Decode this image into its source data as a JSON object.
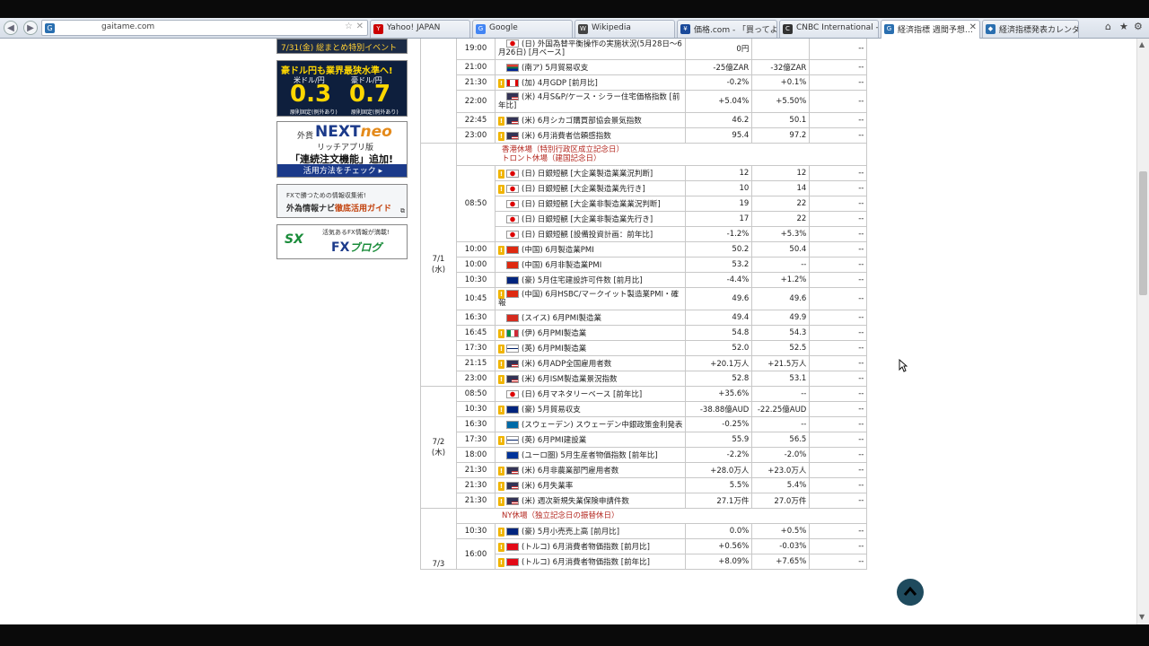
{
  "browser": {
    "address": "gaitame.com",
    "tabs": [
      {
        "label": "Yahoo! JAPAN",
        "color": "#c00",
        "fav": "Y"
      },
      {
        "label": "Google",
        "color": "#4285f4",
        "fav": "G"
      },
      {
        "label": "Wikipedia",
        "color": "#444",
        "fav": "W"
      },
      {
        "label": "価格.com - 「買ってよ…",
        "color": "#1a4a9a",
        "fav": "¥"
      },
      {
        "label": "CNBC International -…",
        "color": "#333",
        "fav": "C"
      },
      {
        "label": "経済指標 週間予想…",
        "color": "#2a6fb0",
        "fav": "G",
        "active": true
      },
      {
        "label": "経済指標発表カレンダ…",
        "color": "#2a6fb0",
        "fav": "◆"
      }
    ]
  },
  "sidebar": {
    "b0": "7/31(金) 総まとめ特別イベント開催!",
    "b1": {
      "headline": "豪ドル円も業界最狭水準へ!",
      "pair1": "米ドル/円",
      "pair2": "豪ドル/円",
      "val1": "0.3",
      "val2": "0.7",
      "unit": "銭",
      "note1": "原則固定(例外あり)",
      "note2": "原則固定(例外あり)"
    },
    "b2": {
      "prefix": "外貨",
      "logo1": "NEXT",
      "logo2": "neo",
      "sub": "リッチアプリ版",
      "feature": "「連続注文機能」追加!",
      "cta": "活用方法をチェック ▸"
    },
    "b3": {
      "line1": "FXで勝つための情報収集術!",
      "line2a": "外為情報ナビ",
      "line2b": "徹底活用ガイド"
    },
    "b4": {
      "logo": "SX",
      "line1": "活気あるFX情報が満載!",
      "line2": "FX",
      "line2b": "ブログ"
    }
  },
  "calendar": {
    "group0": [
      {
        "time": "19:00",
        "imp": false,
        "flag": "jp",
        "event": "(日) 外国為替平衡操作の実施状況(5月28日～6月26日) [月ベース]",
        "wrap": true,
        "prev": "0円",
        "fcst": "",
        "res": "--"
      },
      {
        "time": "21:00",
        "imp": false,
        "flag": "za",
        "event": "(南ア) 5月貿易収支",
        "prev": "-25億ZAR",
        "fcst": "-32億ZAR",
        "res": "--"
      },
      {
        "time": "21:30",
        "imp": true,
        "flag": "ca",
        "event": "(加) 4月GDP [前月比]",
        "prev": "-0.2%",
        "fcst": "+0.1%",
        "res": "--"
      },
      {
        "time": "22:00",
        "imp": false,
        "flag": "us",
        "event": "(米) 4月S&P/ケース・シラー住宅価格指数 [前年比]",
        "wrap": true,
        "prev": "+5.04%",
        "fcst": "+5.50%",
        "res": "--"
      },
      {
        "time": "22:45",
        "imp": true,
        "flag": "us",
        "event": "(米) 6月シカゴ購買部協会景気指数",
        "prev": "46.2",
        "fcst": "50.1",
        "res": "--"
      },
      {
        "time": "23:00",
        "imp": true,
        "flag": "us",
        "event": "(米) 6月消費者信頼感指数",
        "prev": "95.4",
        "fcst": "97.2",
        "res": "--"
      }
    ],
    "day1": {
      "label1": "7/1",
      "label2": "(水)",
      "notes1": "香港休場（特別行政区成立記念日）",
      "notes2": "トロント休場（建国記念日）"
    },
    "tankan_time": "08:50",
    "tankan": [
      {
        "imp": true,
        "flag": "jp",
        "event": "(日) 日銀短観 [大企業製造業業況判断]",
        "prev": "12",
        "fcst": "12",
        "res": "--"
      },
      {
        "imp": true,
        "flag": "jp",
        "event": "(日) 日銀短観 [大企業製造業先行き]",
        "prev": "10",
        "fcst": "14",
        "res": "--"
      },
      {
        "imp": false,
        "flag": "jp",
        "event": "(日) 日銀短観 [大企業非製造業業況判断]",
        "prev": "19",
        "fcst": "22",
        "res": "--"
      },
      {
        "imp": false,
        "flag": "jp",
        "event": "(日) 日銀短観 [大企業非製造業先行き]",
        "prev": "17",
        "fcst": "22",
        "res": "--"
      },
      {
        "imp": false,
        "flag": "jp",
        "event": "(日) 日銀短観 [設備投資計画：前年比]",
        "prev": "-1.2%",
        "fcst": "+5.3%",
        "res": "--"
      }
    ],
    "day1rows": [
      {
        "time": "10:00",
        "imp": true,
        "flag": "cn",
        "event": "(中国) 6月製造業PMI",
        "prev": "50.2",
        "fcst": "50.4",
        "res": "--"
      },
      {
        "time": "10:00",
        "imp": false,
        "flag": "cn",
        "event": "(中国) 6月非製造業PMI",
        "prev": "53.2",
        "fcst": "--",
        "res": "--"
      },
      {
        "time": "10:30",
        "imp": false,
        "flag": "au",
        "event": "(豪) 5月住宅建設許可件数 [前月比]",
        "prev": "-4.4%",
        "fcst": "+1.2%",
        "res": "--"
      },
      {
        "time": "10:45",
        "imp": true,
        "flag": "cn",
        "event": "(中国) 6月HSBC/マークイット製造業PMI・確報",
        "wrap": true,
        "prev": "49.6",
        "fcst": "49.6",
        "res": "--"
      },
      {
        "time": "16:30",
        "imp": false,
        "flag": "ch",
        "event": "(スイス) 6月PMI製造業",
        "prev": "49.4",
        "fcst": "49.9",
        "res": "--"
      },
      {
        "time": "16:45",
        "imp": true,
        "flag": "it",
        "event": "(伊) 6月PMI製造業",
        "prev": "54.8",
        "fcst": "54.3",
        "res": "--"
      },
      {
        "time": "17:30",
        "imp": true,
        "flag": "gb",
        "event": "(英) 6月PMI製造業",
        "prev": "52.0",
        "fcst": "52.5",
        "res": "--"
      },
      {
        "time": "21:15",
        "imp": true,
        "flag": "us",
        "event": "(米) 6月ADP全国雇用者数",
        "prev": "+20.1万人",
        "fcst": "+21.5万人",
        "res": "--"
      },
      {
        "time": "23:00",
        "imp": true,
        "flag": "us",
        "event": "(米) 6月ISM製造業景況指数",
        "prev": "52.8",
        "fcst": "53.1",
        "res": "--"
      }
    ],
    "day2": {
      "label1": "7/2",
      "label2": "(木)"
    },
    "day2rows": [
      {
        "time": "08:50",
        "imp": false,
        "flag": "jp",
        "event": "(日) 6月マネタリーベース [前年比]",
        "prev": "+35.6%",
        "fcst": "--",
        "res": "--"
      },
      {
        "time": "10:30",
        "imp": true,
        "flag": "au",
        "event": "(豪) 5月貿易収支",
        "prev": "-38.88億AUD",
        "fcst": "-22.25億AUD",
        "res": "--"
      },
      {
        "time": "16:30",
        "imp": false,
        "flag": "se",
        "event": "(スウェーデン) スウェーデン中銀政策金利発表",
        "prev": "-0.25%",
        "fcst": "--",
        "res": "--"
      },
      {
        "time": "17:30",
        "imp": true,
        "flag": "gb",
        "event": "(英) 6月PMI建設業",
        "prev": "55.9",
        "fcst": "56.5",
        "res": "--"
      },
      {
        "time": "18:00",
        "imp": false,
        "flag": "eu",
        "event": "(ユーロ圏) 5月生産者物価指数 [前年比]",
        "prev": "-2.2%",
        "fcst": "-2.0%",
        "res": "--"
      },
      {
        "time": "21:30",
        "imp": true,
        "flag": "us",
        "event": "(米) 6月非農業部門雇用者数",
        "prev": "+28.0万人",
        "fcst": "+23.0万人",
        "res": "--"
      },
      {
        "time": "21:30",
        "imp": true,
        "flag": "us",
        "event": "(米) 6月失業率",
        "prev": "5.5%",
        "fcst": "5.4%",
        "res": "--"
      },
      {
        "time": "21:30",
        "imp": true,
        "flag": "us",
        "event": "(米) 週次新規失業保険申請件数",
        "prev": "27.1万件",
        "fcst": "27.0万件",
        "res": "--"
      }
    ],
    "day3": {
      "label1": "7/3",
      "notes": "NY休場（独立記念日の振替休日）"
    },
    "day3rows": [
      {
        "time": "10:30",
        "imp": true,
        "flag": "au",
        "event": "(豪) 5月小売売上高 [前月比]",
        "prev": "0.0%",
        "fcst": "+0.5%",
        "res": "--"
      },
      {
        "time": "16:00",
        "imp": true,
        "flag": "tr",
        "event": "(トルコ) 6月消費者物価指数 [前月比]",
        "prev": "+0.56%",
        "fcst": "-0.03%",
        "res": "--"
      },
      {
        "time": "",
        "imp": true,
        "flag": "tr",
        "event": "(トルコ) 6月消費者物価指数 [前年比]",
        "prev": "+8.09%",
        "fcst": "+7.65%",
        "res": "--"
      }
    ]
  }
}
